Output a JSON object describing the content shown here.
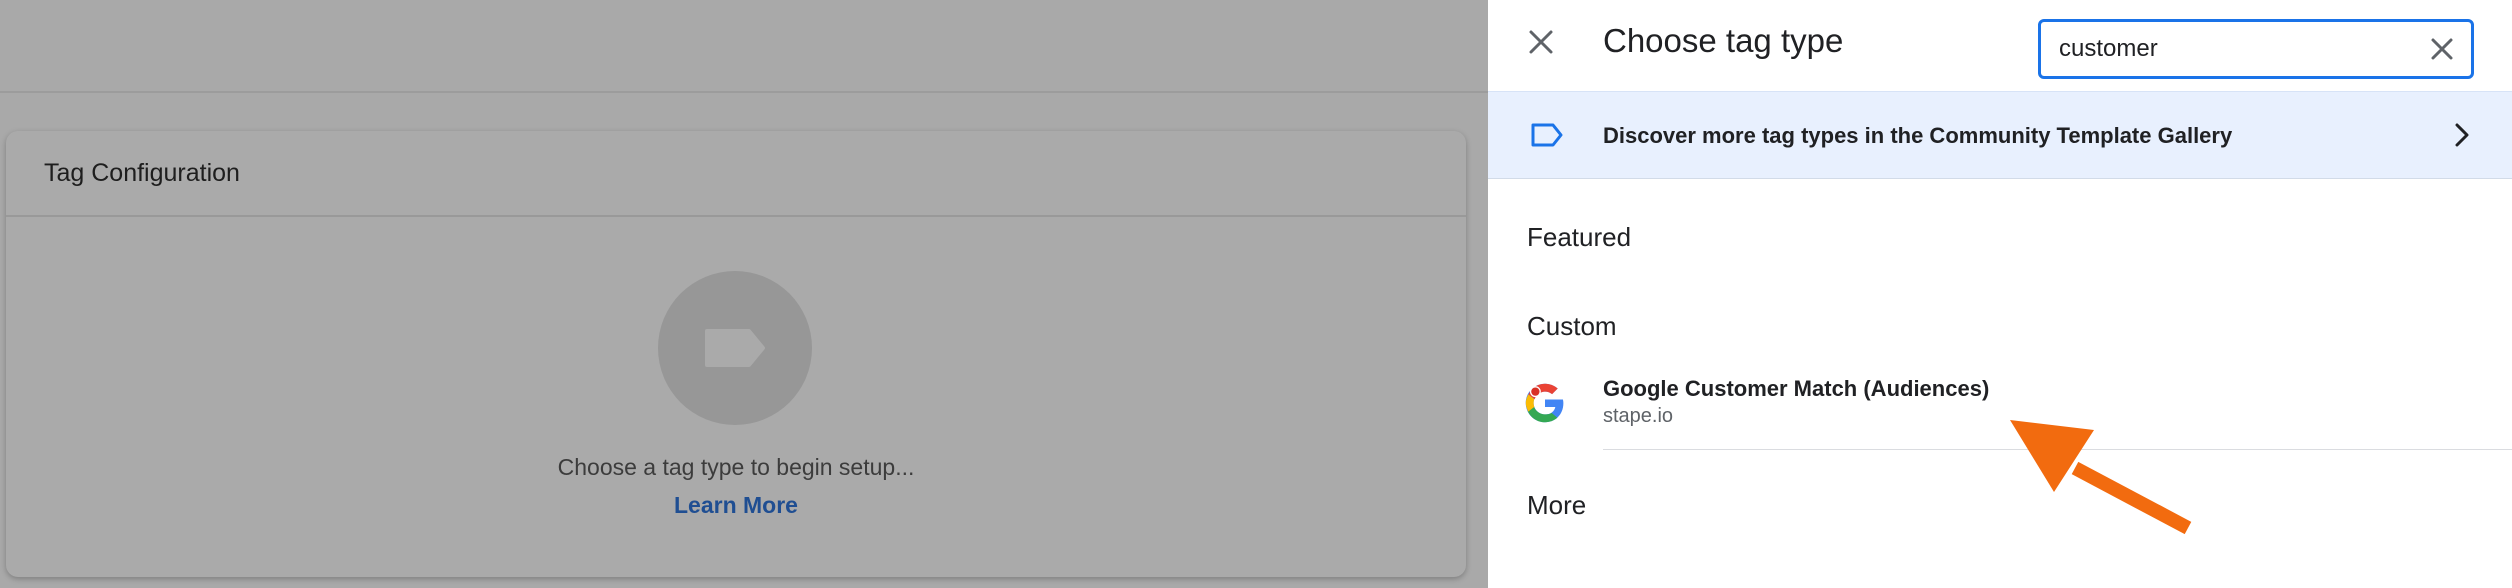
{
  "background_page": {
    "card_title": "Tag Configuration",
    "hint": "Choose a tag type to begin setup...",
    "learn_more": "Learn More"
  },
  "panel": {
    "title": "Choose tag type",
    "search": {
      "value": "customer"
    },
    "discover_banner": "Discover more tag types in the Community Template Gallery",
    "sections": {
      "featured": "Featured",
      "custom": "Custom",
      "more": "More"
    },
    "results": [
      {
        "name": "Google Customer Match (Audiences)",
        "vendor": "stape.io",
        "icon": "google-g-logo"
      }
    ]
  },
  "colors": {
    "accent": "#1a73e8",
    "banner_bg": "#e8f0fe",
    "annotation_arrow": "#f26b0f",
    "overlay": "#a9a9a9"
  },
  "icons": [
    "close-icon",
    "clear-search-icon",
    "tag-icon",
    "chevron-right-icon",
    "google-g-logo",
    "arrow-annotation"
  ]
}
